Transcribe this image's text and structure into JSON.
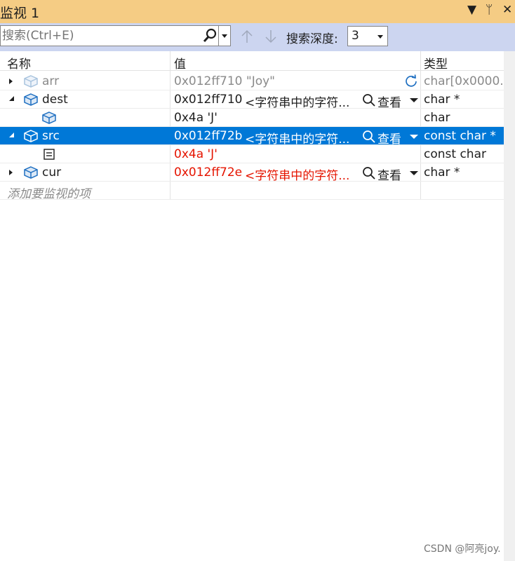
{
  "window": {
    "title": "监视 1",
    "title_buttons": [
      "▼",
      "ᛘ",
      "✕"
    ]
  },
  "toolbar": {
    "search_placeholder": "搜索(Ctrl+E)",
    "depth_label": "搜索深度:",
    "depth_value": "3"
  },
  "columns": {
    "name": "名称",
    "value": "值",
    "type": "类型"
  },
  "rows": [
    {
      "name": "arr",
      "value": "0x012ff710 \"Joy\"",
      "preview": "",
      "viewer": "",
      "type": "char[0x0000...",
      "state": "stale"
    },
    {
      "name": "dest",
      "value": "0x012ff710",
      "preview": "<字符串中的字符...",
      "viewer": "查看",
      "type": "char *",
      "state": "normal"
    },
    {
      "name": "",
      "value": "0x4a 'J'",
      "preview": "",
      "viewer": "",
      "type": "char",
      "state": "normal"
    },
    {
      "name": "src",
      "value": "0x012ff72b",
      "preview": "<字符串中的字符...",
      "viewer": "查看",
      "type": "const char *",
      "state": "selected"
    },
    {
      "name": "",
      "value": "0x4a 'J'",
      "preview": "",
      "viewer": "",
      "type": "const char",
      "state": "changed"
    },
    {
      "name": "cur",
      "value": "0x012ff72e",
      "preview": "<字符串中的字符...",
      "viewer": "查看",
      "type": "char *",
      "state": "changed"
    }
  ],
  "add_item_placeholder": "添加要监视的项",
  "watermark": "CSDN @阿亮joy.",
  "colors": {
    "title_bar": "#f5cc84",
    "toolbar": "#ccd5f0",
    "selection": "#0078d7",
    "changed_value": "#e51400",
    "stale_text": "#8a8a8a"
  },
  "icons": [
    "search-icon",
    "arrow-up-icon",
    "arrow-down-icon",
    "refresh-icon",
    "variable-icon",
    "field-icon",
    "magnifier-icon"
  ]
}
